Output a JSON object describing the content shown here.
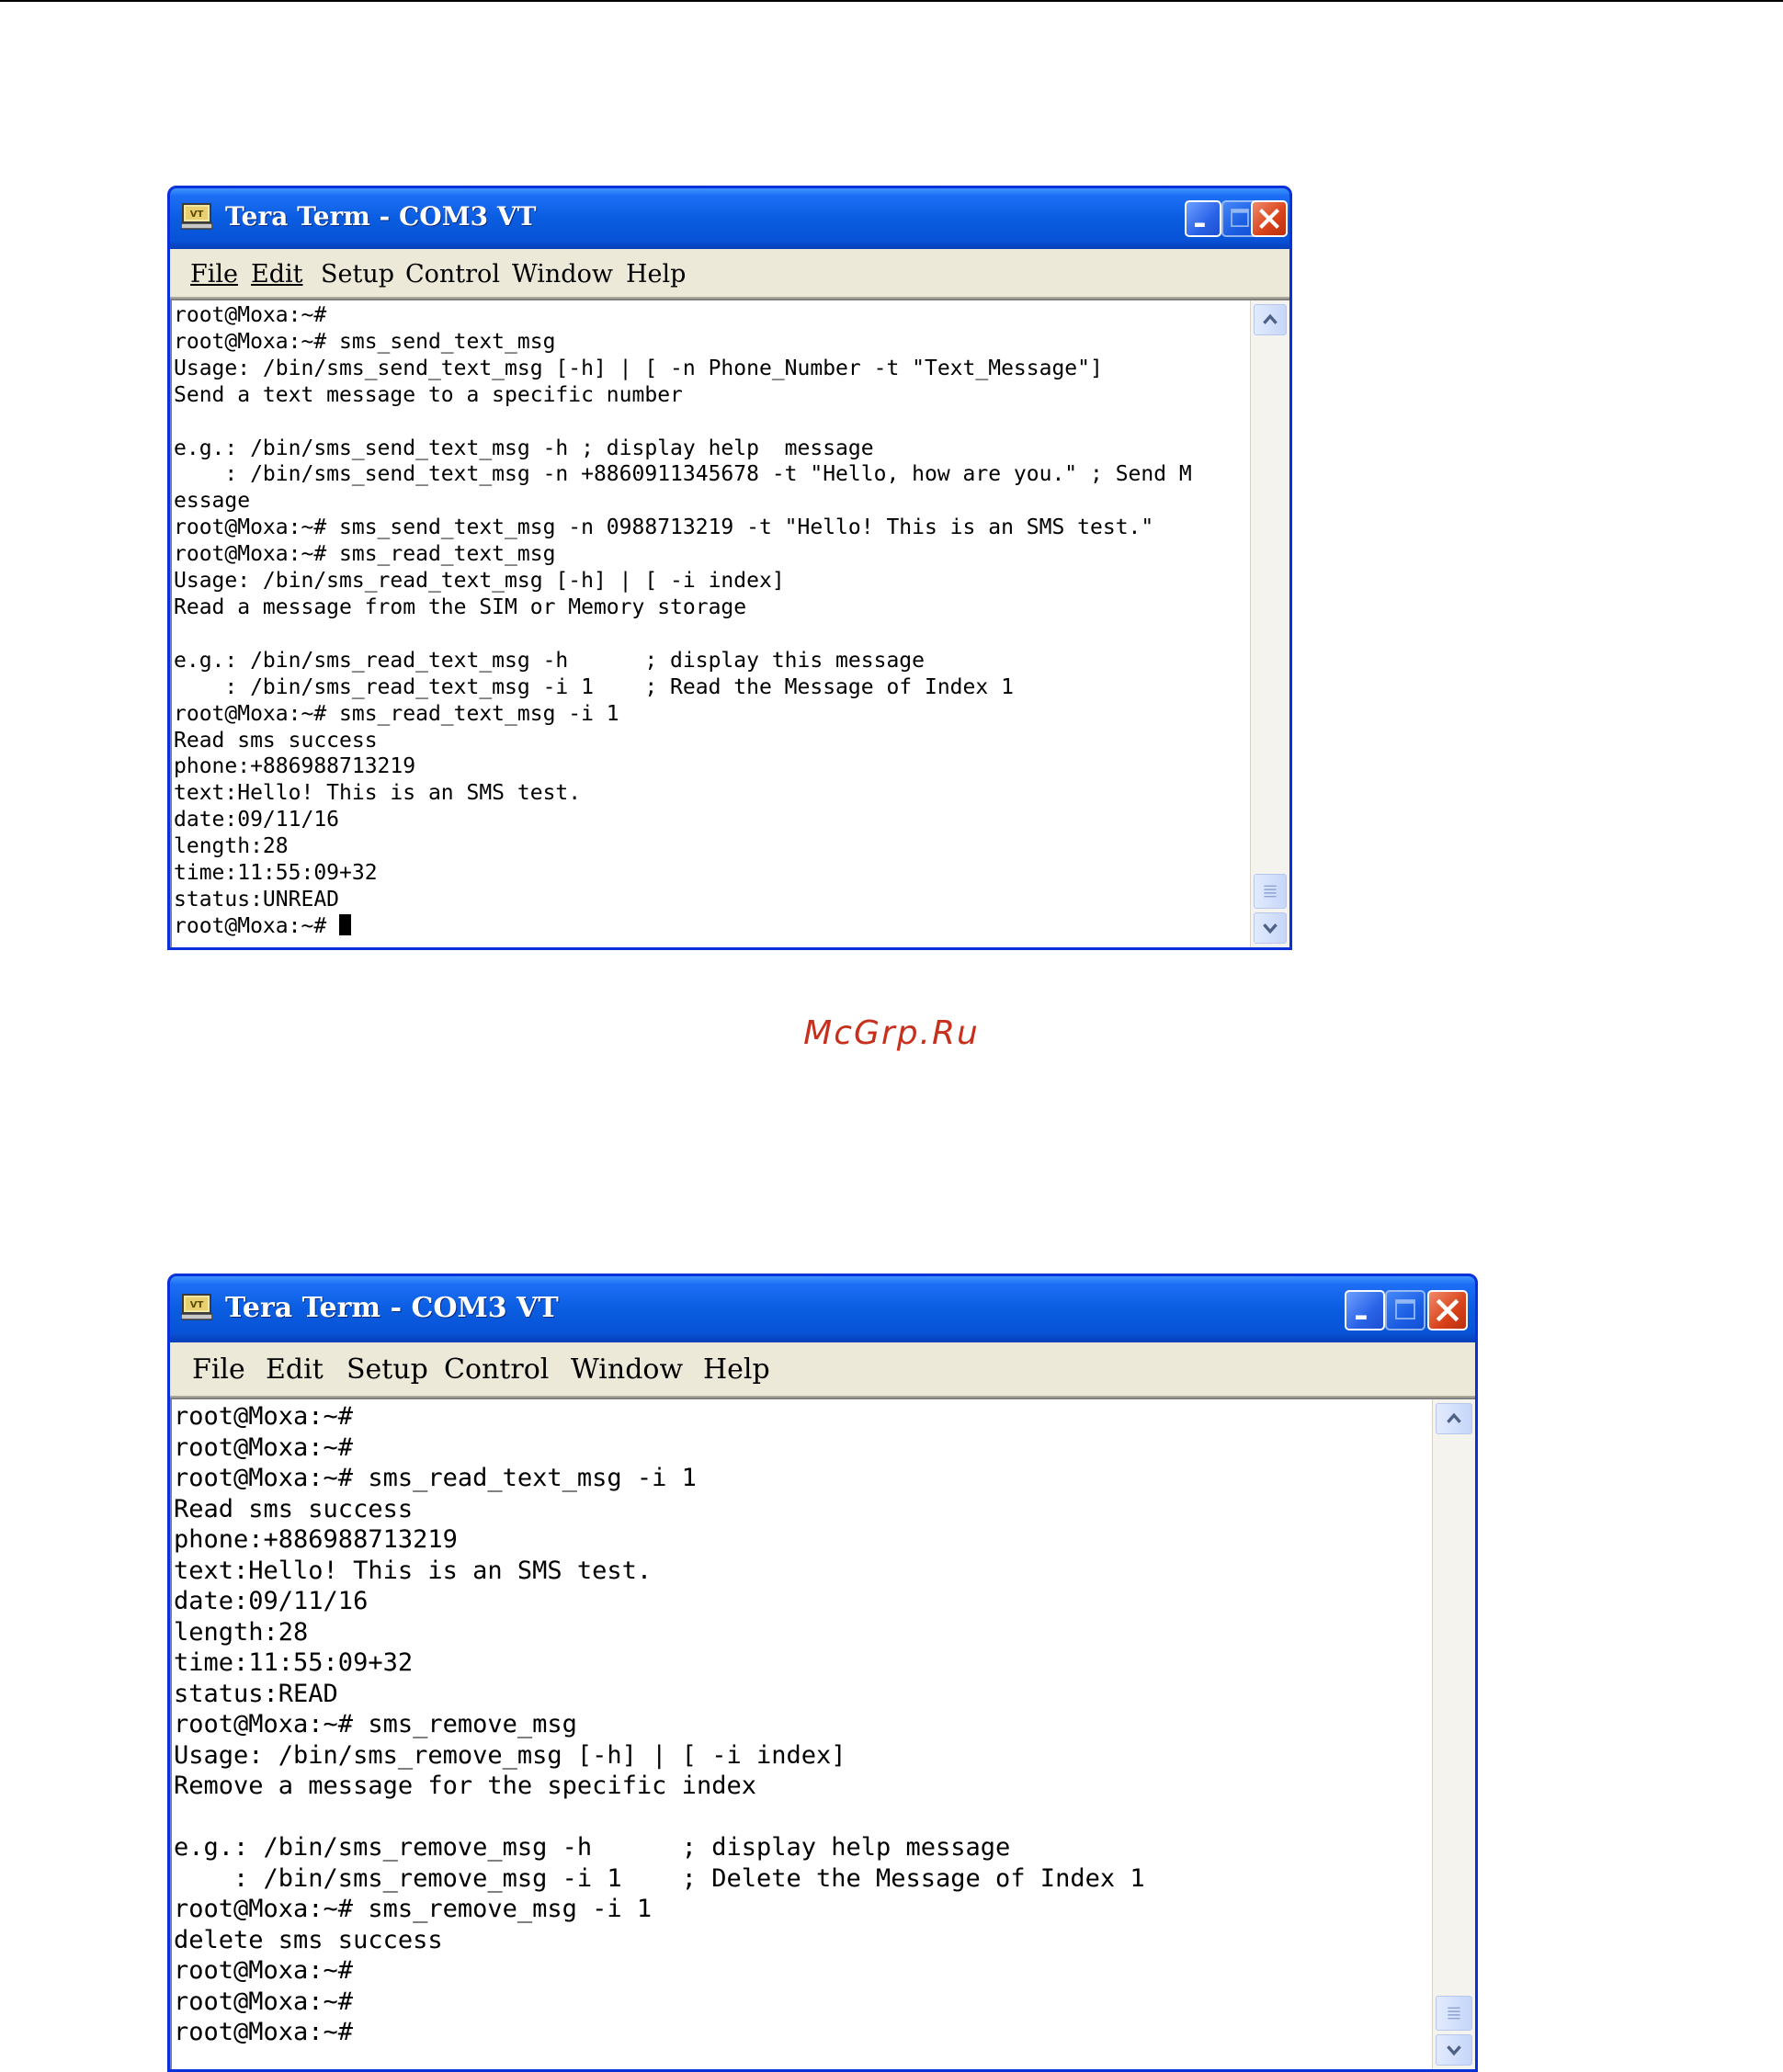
{
  "windows": [
    {
      "title": "Tera Term - COM3 VT",
      "icon": "vt-terminal-icon",
      "menu": [
        "File",
        "Edit",
        "Setup",
        "Control",
        "Window",
        "Help"
      ],
      "buttons": {
        "minimize": "minimize-icon",
        "maximize": "maximize-icon",
        "close": "close-icon"
      },
      "terminal_lines": [
        "root@Moxa:~#",
        "root@Moxa:~# sms_send_text_msg",
        "Usage: /bin/sms_send_text_msg [-h] | [ -n Phone_Number -t \"Text_Message\"]",
        "Send a text message to a specific number",
        "",
        "e.g.: /bin/sms_send_text_msg -h ; display help  message",
        "    : /bin/sms_send_text_msg -n +8860911345678 -t \"Hello, how are you.\" ; Send M",
        "essage",
        "root@Moxa:~# sms_send_text_msg -n 0988713219 -t \"Hello! This is an SMS test.\"",
        "root@Moxa:~# sms_read_text_msg",
        "Usage: /bin/sms_read_text_msg [-h] | [ -i index]",
        "Read a message from the SIM or Memory storage",
        "",
        "e.g.: /bin/sms_read_text_msg -h      ; display this message",
        "    : /bin/sms_read_text_msg -i 1    ; Read the Message of Index 1",
        "root@Moxa:~# sms_read_text_msg -i 1",
        "Read sms success",
        "phone:+886988713219",
        "text:Hello! This is an SMS test.",
        "date:09/11/16",
        "length:28",
        "time:11:55:09+32",
        "status:UNREAD",
        "root@Moxa:~# "
      ]
    },
    {
      "title": "Tera Term - COM3 VT",
      "icon": "vt-terminal-icon",
      "menu": [
        "File",
        "Edit",
        "Setup",
        "Control",
        "Window",
        "Help"
      ],
      "buttons": {
        "minimize": "minimize-icon",
        "maximize": "maximize-icon",
        "close": "close-icon"
      },
      "terminal_lines": [
        "root@Moxa:~#",
        "root@Moxa:~#",
        "root@Moxa:~# sms_read_text_msg -i 1",
        "Read sms success",
        "phone:+886988713219",
        "text:Hello! This is an SMS test.",
        "date:09/11/16",
        "length:28",
        "time:11:55:09+32",
        "status:READ",
        "root@Moxa:~# sms_remove_msg",
        "Usage: /bin/sms_remove_msg [-h] | [ -i index]",
        "Remove a message for the specific index",
        "",
        "e.g.: /bin/sms_remove_msg -h      ; display help message",
        "    : /bin/sms_remove_msg -i 1    ; Delete the Message of Index 1",
        "root@Moxa:~# sms_remove_msg -i 1",
        "delete sms success",
        "root@Moxa:~#",
        "root@Moxa:~#",
        "root@Moxa:~#"
      ]
    }
  ],
  "watermark": "McGrp.Ru",
  "colors": {
    "titlebar": "#0a5de0",
    "menubar": "#ece9d8",
    "close_button": "#d8421a",
    "watermark": "#c8301e",
    "terminal_bg": "#ffffff",
    "terminal_fg": "#000000"
  }
}
